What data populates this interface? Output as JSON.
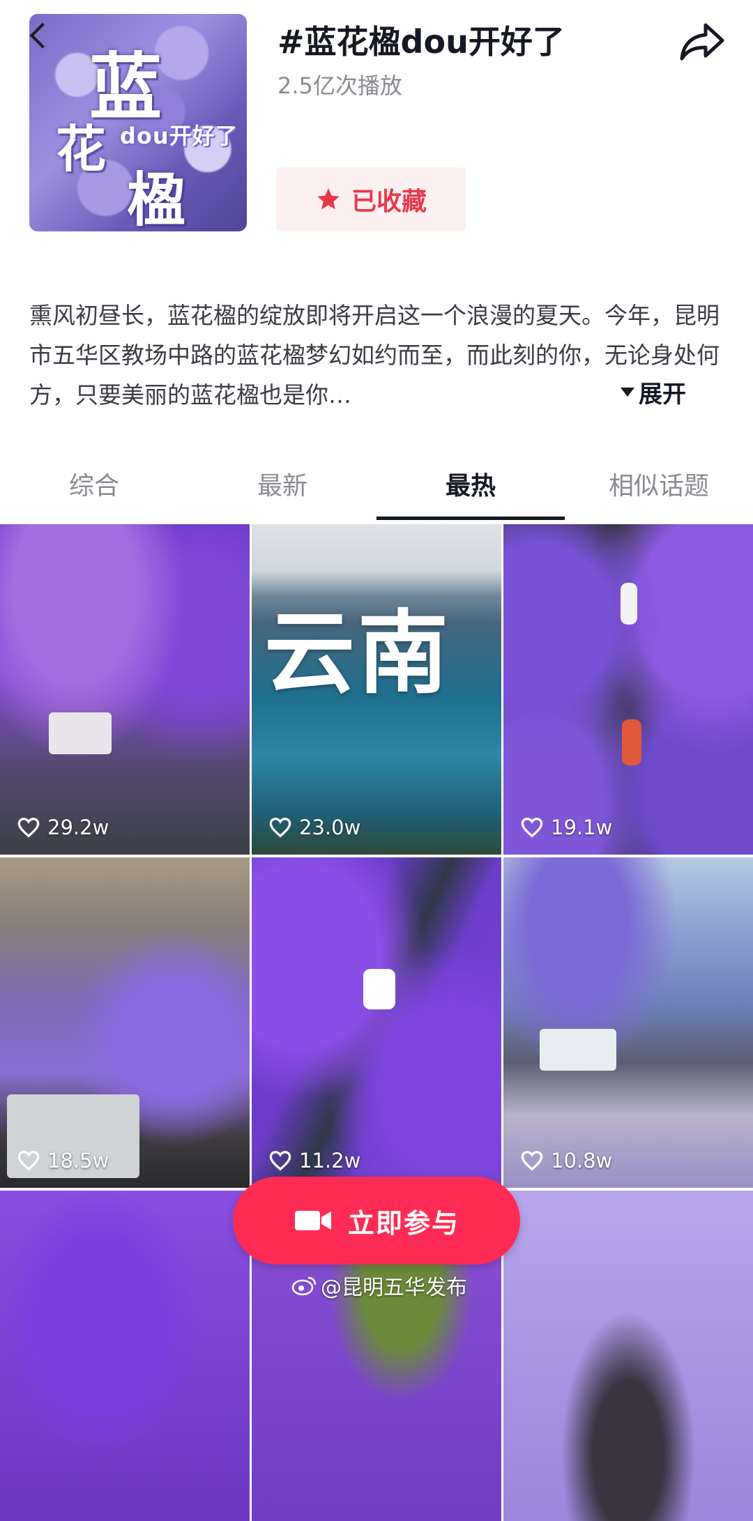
{
  "header": {
    "cover": {
      "title_line1": "蓝",
      "title_line2": "花",
      "title_line3": "楹",
      "subtitle": "dou开好了"
    },
    "title": "#蓝花楹dou开好了",
    "plays": "2.5亿次播放",
    "collect_label": "已收藏"
  },
  "description": {
    "text": "熏风初昼长，蓝花楹的绽放即将开启这一个浪漫的夏天。今年，昆明市五华区教场中路的蓝花楹梦幻如约而至，而此刻的你，无论身处何方，只要美丽的蓝花楹也是你…",
    "expand_label": "展开"
  },
  "tabs": [
    {
      "label": "综合",
      "active": false
    },
    {
      "label": "最新",
      "active": false
    },
    {
      "label": "最热",
      "active": true
    },
    {
      "label": "相似话题",
      "active": false
    }
  ],
  "videos": [
    {
      "likes": "29.2w"
    },
    {
      "likes": "23.0w",
      "overlay_text": "云南"
    },
    {
      "likes": "19.1w"
    },
    {
      "likes": "18.5w"
    },
    {
      "likes": "11.2w"
    },
    {
      "likes": "10.8w"
    },
    {
      "likes": ""
    },
    {
      "likes": ""
    },
    {
      "likes": ""
    }
  ],
  "join_button": {
    "label": "立即参与"
  },
  "watermark": "@昆明五华发布",
  "colors": {
    "accent": "#fe2c55",
    "collect_bg": "#fdf0f1",
    "collect_text": "#e8394b",
    "text_primary": "#161823",
    "text_secondary": "#8a8b91"
  },
  "icons": [
    "back-icon",
    "share-icon",
    "star-icon",
    "heart-icon",
    "camera-icon",
    "weibo-icon"
  ]
}
